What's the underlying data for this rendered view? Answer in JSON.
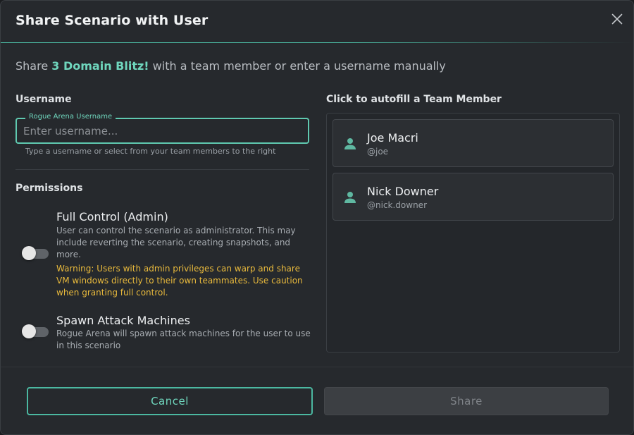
{
  "dialog": {
    "title": "Share Scenario with User",
    "close_icon": "close-icon"
  },
  "subtitle": {
    "prefix": "Share",
    "scenario_name": "3 Domain Blitz!",
    "suffix": "with a team member or enter a username manually"
  },
  "username": {
    "label": "Username",
    "field_legend": "Rogue Arena Username",
    "placeholder": "Enter username...",
    "value": "",
    "helper": "Type a username or select from your team members to the right"
  },
  "permissions": {
    "label": "Permissions",
    "items": [
      {
        "title": "Full Control (Admin)",
        "description": "User can control the scenario as administrator. This may include reverting the scenario, creating snapshots, and more.",
        "warning": "Warning: Users with admin privileges can warp and share VM windows directly to their own teammates. Use caution when granting full control.",
        "enabled": false
      },
      {
        "title": "Spawn Attack Machines",
        "description": "Rogue Arena will spawn attack machines for the user to use in this scenario",
        "enabled": false
      }
    ]
  },
  "team_members": {
    "label": "Click to autofill a Team Member",
    "members": [
      {
        "name": "Joe Macri",
        "handle": "@joe",
        "icon": "person-icon"
      },
      {
        "name": "Nick Downer",
        "handle": "@nick.downer",
        "icon": "person-icon"
      }
    ]
  },
  "actions": {
    "cancel_label": "Cancel",
    "share_label": "Share"
  },
  "colors": {
    "accent": "#6fd6bd",
    "warning": "#e8b93c",
    "background": "#26292d"
  }
}
